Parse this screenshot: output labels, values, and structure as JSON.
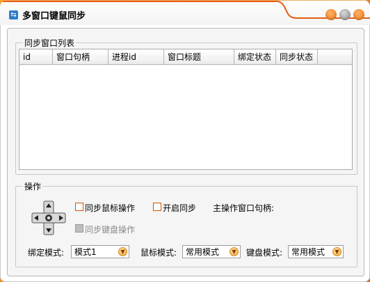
{
  "window": {
    "title": "多窗口键鼠同步",
    "accent_color": "#e65c14",
    "buttons": [
      {
        "name": "minimize",
        "color": "#f07a1c"
      },
      {
        "name": "maximize",
        "color": "#9b9b9b"
      },
      {
        "name": "close",
        "color": "#f07a1c"
      }
    ]
  },
  "sync_list": {
    "group_label": "同步窗口列表",
    "columns": [
      "id",
      "窗口句柄",
      "进程id",
      "窗口标题",
      "绑定状态",
      "同步状态"
    ],
    "rows": []
  },
  "operations": {
    "group_label": "操作",
    "sync_mouse": {
      "label": "同步鼠标操作",
      "checked": false,
      "enabled": true
    },
    "start_sync": {
      "label": "开启同步",
      "checked": false,
      "enabled": true
    },
    "main_handle_label": "主操作窗口句柄:",
    "sync_keyboard": {
      "label": "同步键盘操作",
      "checked": false,
      "enabled": false
    },
    "bind_mode": {
      "label": "绑定模式:",
      "value": "模式1"
    },
    "mouse_mode": {
      "label": "鼠标模式:",
      "value": "常用模式"
    },
    "keyboard_mode": {
      "label": "键盘模式:",
      "value": "常用模式"
    }
  }
}
